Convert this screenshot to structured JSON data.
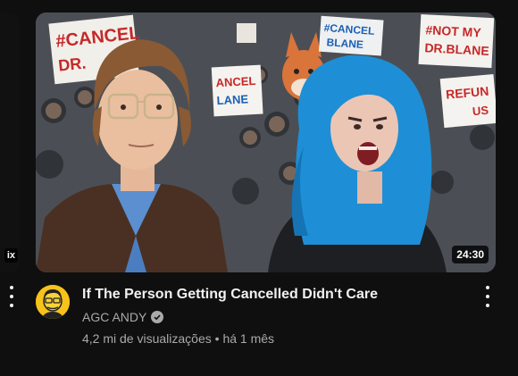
{
  "previous_card": {
    "badge": "ix"
  },
  "video": {
    "duration": "24:30",
    "title": "If The Person Getting Cancelled Didn't Care",
    "channel": "AGC ANDY",
    "views": "4,2 mi de visualizações",
    "separator": "•",
    "age": "há 1 mês",
    "thumbnail_signs": {
      "sign1_line1": "#CANCEL",
      "sign1_line2": "DR.",
      "sign2_line1": "#CANCEL",
      "sign2_line2": "BLANE",
      "sign3_line1": "#NOT MY",
      "sign3_line2": "DR.BLANE",
      "sign4_line1": "ANCEL",
      "sign4_line2": "LANE",
      "sign5_line1": "REFUN",
      "sign5_line2": "US",
      "sign6": "SIGN"
    }
  },
  "icons": {
    "verified": "verified-check-icon",
    "menu": "more-vert-icon"
  },
  "colors": {
    "background": "#0f0f0f",
    "secondary_text": "#aaaaaa",
    "hair_blue": "#1e8fd6"
  }
}
